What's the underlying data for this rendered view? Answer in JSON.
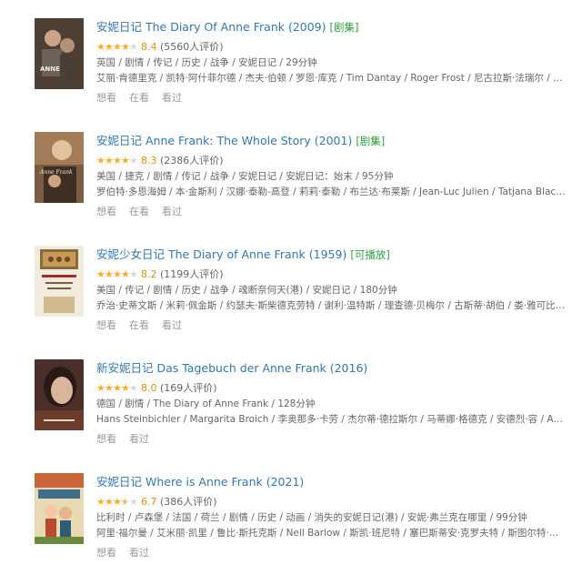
{
  "items": [
    {
      "title": "安妮日记 The Diary Of Anne Frank (2009)",
      "tag": "[剧集]",
      "stars": 4,
      "score": "8.4",
      "count": "(5560人评价)",
      "tags_line": "英国 / 剧情 / 传记 / 历史 / 战争 / 安妮日记 / 29分钟",
      "cast_line": "艾丽·肯德里克 / 凯特·阿什菲尔德 / 杰夫·伯顿 / 罗恩·库克 / Tim Dantay / Roger Frost / 尼古拉斯·法瑞尔 / 伊恩·...",
      "actions": [
        "想看",
        "在看",
        "看过"
      ]
    },
    {
      "title": "安妮日记 Anne Frank: The Whole Story (2001)",
      "tag": "[剧集]",
      "stars": 4,
      "score": "8.3",
      "count": "(2386人评价)",
      "tags_line": "美国 / 捷克 / 剧情 / 传记 / 战争 / 安妮日记 / 安妮日记：始末 / 95分钟",
      "cast_line": "罗伯特·多恩海姆 / 本·金斯利 / 汉娜·泰勒-高登 / 莉莉·泰勒 / 布兰达·布莱斯 / Jean-Luc Julien / Tatjana Blacher / ...",
      "actions": [
        "想看",
        "在看",
        "看过"
      ]
    },
    {
      "title": "安妮少女日记 The Diary of Anne Frank (1959)",
      "tag": "[可播放]",
      "stars": 4,
      "score": "8.2",
      "count": "(1199人评价)",
      "tags_line": "美国 / 传记 / 剧情 / 历史 / 战争 / 魂断奈何天(港) / 安妮日记 / 180分钟",
      "cast_line": "乔治·史蒂文斯 / 米莉·佩金斯 / 约瑟夫·斯柴德克劳特 / 谢利·温特斯 / 理查德·贝梅尔 / 古斯蒂·胡伯 / 娄·雅可比 / ...",
      "actions": [
        "想看",
        "在看",
        "看过"
      ]
    },
    {
      "title": "新安妮日记 Das Tagebuch der Anne Frank (2016)",
      "tag": "",
      "stars": 4,
      "score": "8.0",
      "count": "(169人评价)",
      "tags_line": "德国 / 剧情 / The Diary of Anne Frank / 128分钟",
      "cast_line": "Hans Steinbichler / Margarita Broich / 李奥那多·卡劳 / 杰尔蒂·德拉斯尔 / 马蒂娜·格德克 / 安德烈·容 / Arthur Kl...",
      "actions": [
        "想看",
        "看过"
      ]
    },
    {
      "title": "安妮日记 Where is Anne Frank (2021)",
      "tag": "",
      "stars": 3.5,
      "score": "6.7",
      "count": "(386人评价)",
      "tags_line": "比利时 / 卢森堡 / 法国 / 荷兰 / 剧情 / 历史 / 动画 / 消失的安妮日记(港) / 安妮·弗兰克在哪里 / 99分钟",
      "cast_line": "阿里·福尔曼 / 艾米丽·凯里 / 鲁比·斯托克斯 / Nell Barlow / 斯凯·班尼特 / 塞巴斯蒂安·克罗夫特 / 斯图尔特·斯卡...",
      "actions": [
        "想看",
        "看过"
      ]
    }
  ]
}
